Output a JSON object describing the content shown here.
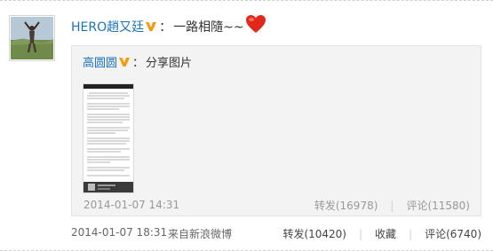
{
  "post": {
    "username": "HERO趙又廷",
    "colon": "：",
    "text": "一路相隨~~",
    "timestamp": "2014-01-07 18:31",
    "source": "来自新浪微博",
    "actions": {
      "repost": "转发(10420)",
      "favorite": "收藏",
      "comment": "评论(6740)"
    }
  },
  "repost": {
    "username": "高圆圆",
    "colon": "：",
    "text": "分享图片",
    "timestamp": "2014-01-07 14:31",
    "actions": {
      "repost": "转发(16978)",
      "comment": "评论(11580)"
    }
  },
  "separator": "|",
  "icons": {
    "verified": "verified-v-icon",
    "heart": "heart-icon"
  },
  "colors": {
    "link": "#1a73b8",
    "verified": "#f29a11",
    "heart": "#e0291b",
    "repost_bg": "#f3f3f3",
    "muted": "#999999"
  }
}
